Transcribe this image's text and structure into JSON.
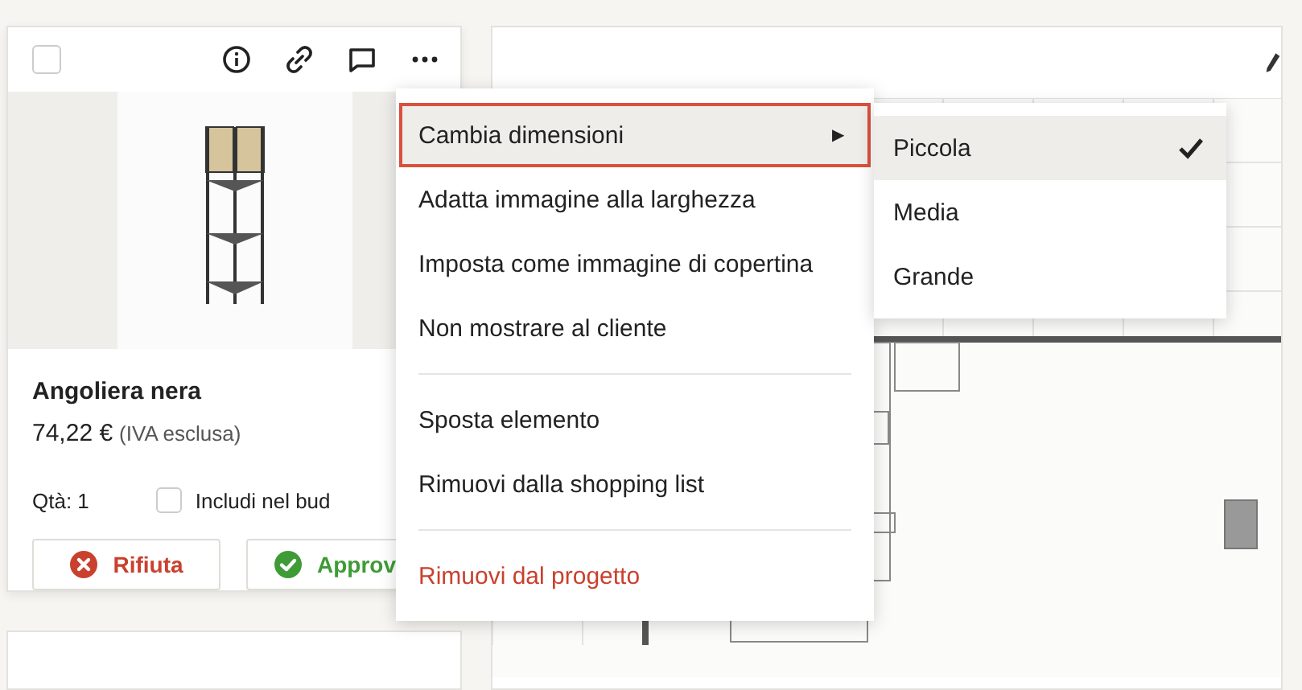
{
  "card": {
    "checked": false,
    "name": "Angoliera nera",
    "price": "74,22 €",
    "vat_note": "(IVA esclusa)",
    "quantity": "Qtà: 1",
    "include_option": {
      "label": "Includi nel bud",
      "checked": false
    },
    "buttons": [
      {
        "kind": "reject",
        "label": "Rifiuta"
      },
      {
        "kind": "approve",
        "label": "Approv"
      }
    ]
  },
  "context_menu": {
    "items": [
      {
        "kind": "submenu",
        "label": "Cambia dimensioni",
        "selected": true,
        "arrow": "▶"
      },
      {
        "kind": "item",
        "label": "Adatta immagine alla larghezza",
        "selected": false
      },
      {
        "kind": "item",
        "label": "Imposta come immagine di copertina",
        "selected": false
      },
      {
        "kind": "item",
        "label": "Non mostrare al cliente",
        "selected": false
      },
      {
        "kind": "divider"
      },
      {
        "kind": "item",
        "label": "Sposta elemento",
        "selected": false
      },
      {
        "kind": "item",
        "label": "Rimuovi dalla shopping list",
        "selected": false
      },
      {
        "kind": "divider"
      },
      {
        "kind": "danger",
        "label": "Rimuovi dal progetto",
        "selected": false
      }
    ]
  },
  "submenu": {
    "items": [
      {
        "label": "Piccola",
        "selected": true,
        "checked": true
      },
      {
        "label": "Media",
        "selected": false,
        "checked": false
      },
      {
        "label": "Grande",
        "selected": false,
        "checked": false
      }
    ]
  }
}
